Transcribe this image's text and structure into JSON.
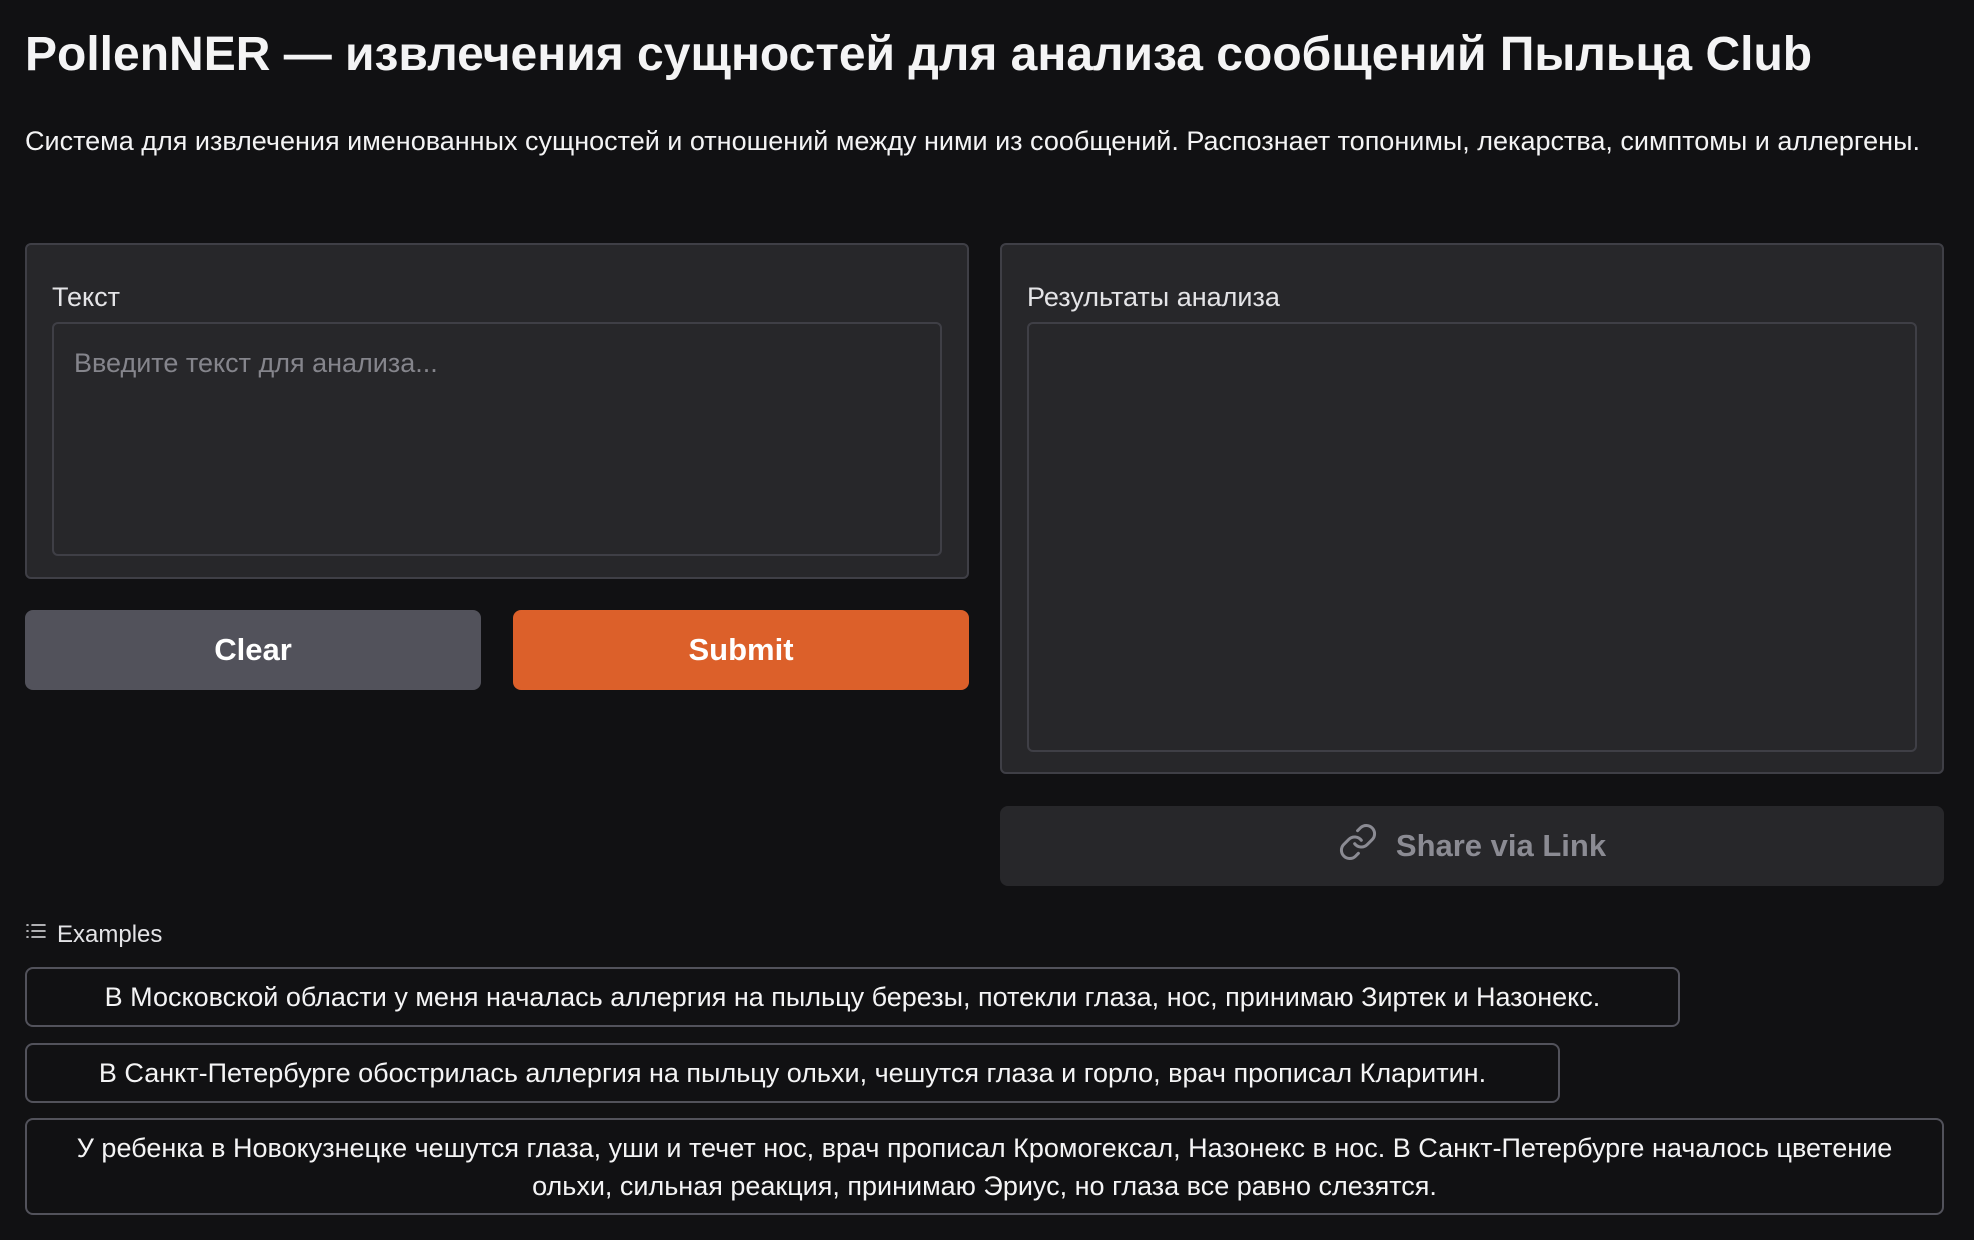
{
  "header": {
    "title": "PollenNER — извлечения сущностей для анализа сообщений Пыльца Club",
    "description": "Система для извлечения именованных сущностей и отношений между ними из сообщений. Распознает топонимы, лекарства, симптомы и аллергены."
  },
  "input_panel": {
    "label": "Текст",
    "value": "",
    "placeholder": "Введите текст для анализа..."
  },
  "output_panel": {
    "label": "Результаты анализа"
  },
  "buttons": {
    "clear_label": "Clear",
    "submit_label": "Submit",
    "share_label": "Share via Link",
    "share_icon": "link-icon"
  },
  "examples": {
    "header_label": "Examples",
    "header_icon": "list-icon",
    "items": [
      "В Московской области у меня началась аллергия на пыльцу березы, потекли глаза, нос, принимаю Зиртек и Назонекс.",
      "В Санкт-Петербурге обострилась аллергия на пыльцу ольхи, чешутся глаза и горло, врач прописал Кларитин.",
      "У ребенка в Новокузнецке чешутся глаза, уши и течет нос, врач прописал Кромогексал, Назонекс в нос. В Санкт-Петербурге началось цветение ольхи, сильная реакция, принимаю Эриус, но глаза все равно слезятся."
    ]
  },
  "colors": {
    "background": "#111113",
    "panel": "#27272a",
    "border": "#3f3f46",
    "accent": "#dc602a",
    "secondary_button": "#52525b"
  }
}
